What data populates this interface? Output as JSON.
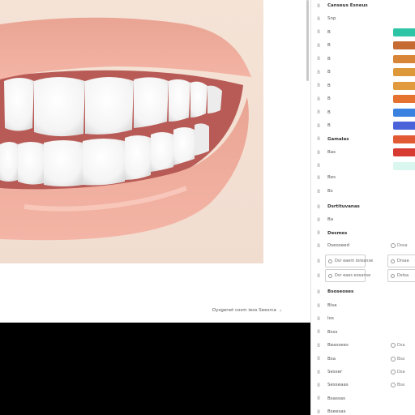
{
  "viewer": {
    "caption": "Dysgenet cosm ieos Seesrca",
    "caption_chevron": "chevron-right-icon"
  },
  "panel": {
    "title": "Canseus Esneus",
    "color_rows": [
      {
        "label": "Snp",
        "color": null
      },
      {
        "label": "B",
        "color": "#2ec5a6"
      },
      {
        "label": "B",
        "color": "#c66a33"
      },
      {
        "label": "B",
        "color": "#d98537"
      },
      {
        "label": "B",
        "color": "#dd983a"
      },
      {
        "label": "B",
        "color": "#e19a3e"
      },
      {
        "label": "B",
        "color": "#e5722f"
      },
      {
        "label": "B",
        "color": "#3b82e0"
      },
      {
        "label": "B",
        "color": "#4b63d9"
      },
      {
        "label": "Gamalas",
        "color": "#e15a33"
      },
      {
        "label": "Bas",
        "color": "#d63a30"
      },
      {
        "label": "",
        "color": "#d9f7ef"
      }
    ],
    "misc_rows": [
      {
        "label": "Bes"
      },
      {
        "label": "Bs"
      }
    ],
    "section_a": "Dsrtituvanas",
    "section_a_rows": [
      {
        "label": "Ba"
      },
      {
        "label": "Desmes"
      }
    ],
    "option_rows": [
      {
        "label": "Dseoseed",
        "radio_label": "Dosa"
      }
    ],
    "box_row_1": {
      "left": "Dsr eaem ioreanse",
      "right": "Drsae"
    },
    "box_row_2": {
      "left": "Dsr eaes eosanse",
      "right": "Dstsa"
    },
    "section_b": "Bsoseoses",
    "section_b_rows": [
      {
        "label": "Bisa",
        "radio_label": ""
      },
      {
        "label": "Ios",
        "radio_label": ""
      },
      {
        "label": "Bsss",
        "radio_label": ""
      },
      {
        "label": "Beassees",
        "radio_label": "Dsa"
      },
      {
        "label": "Bsa",
        "radio_label": "Bsa"
      },
      {
        "label": "Sesser",
        "radio_label": "Dsa"
      },
      {
        "label": "Sesseaas",
        "radio_label": "Bsa"
      },
      {
        "label": "Bsassas",
        "radio_label": ""
      },
      {
        "label": "Bseesas",
        "radio_label": ""
      }
    ]
  },
  "colors": {
    "background": "#ffffff",
    "band": "#000000",
    "panel_border": "#e4e4e4"
  }
}
